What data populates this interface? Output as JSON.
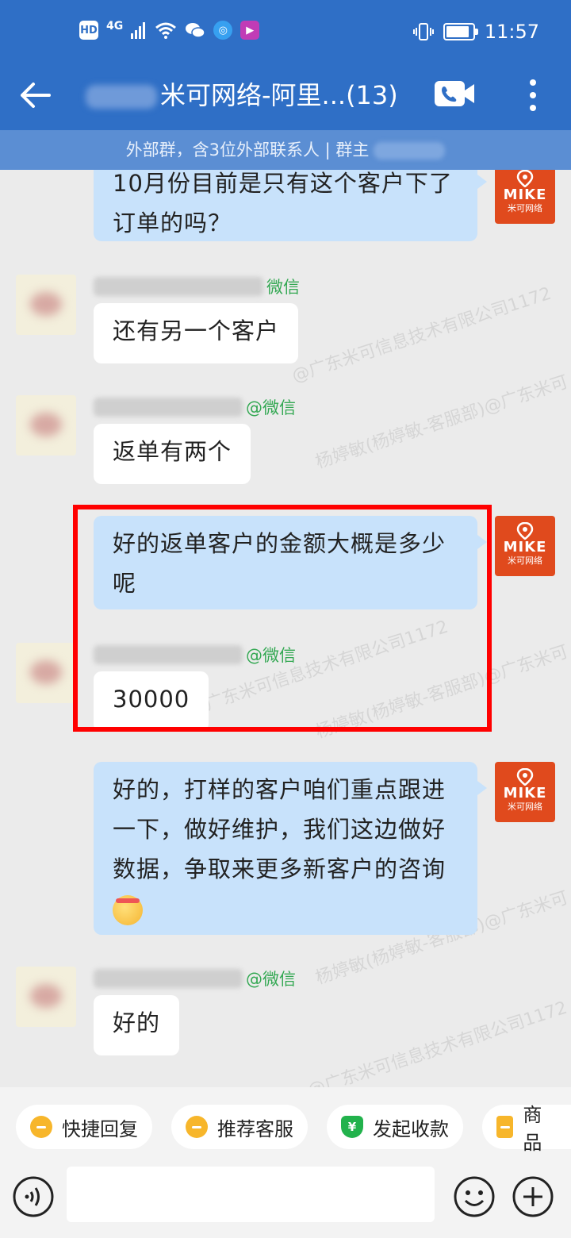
{
  "status_bar": {
    "network_hd": "HD",
    "network_gen": "4G",
    "time": "11:57",
    "icons": [
      "signal-icon",
      "wifi-icon",
      "wechat-icon",
      "browser-icon",
      "app-icon",
      "vibrate-icon",
      "battery-icon"
    ]
  },
  "header": {
    "title": "米可网络-阿里...(13)",
    "subtitle": "外部群，含3位外部联系人 | 群主"
  },
  "watermark": {
    "company_line": "@广东米可信息技术有限公司1172",
    "user_line": "杨婷敏(杨婷敏-客服部)@广东米可"
  },
  "brand": {
    "name": "MIKE",
    "sub": "米可网络",
    "color": "#e04a1d"
  },
  "messages": [
    {
      "from": "me",
      "text": "10月份目前是只有这个客户下了订单的吗？"
    },
    {
      "from": "them",
      "sender_suffix": "微信",
      "text": "还有另一个客户"
    },
    {
      "from": "them",
      "sender_suffix": "@微信",
      "text": "返单有两个"
    },
    {
      "from": "me",
      "text": "好的返单客户的金额大概是多少呢"
    },
    {
      "from": "them",
      "sender_suffix": "@微信",
      "text": "30000"
    },
    {
      "from": "me",
      "text": "好的，打样的客户咱们重点跟进一下，做好维护，我们这边做好数据，争取来更多新客户的咨询"
    },
    {
      "from": "them",
      "sender_suffix": "@微信",
      "text": "好的"
    }
  ],
  "quick_actions": [
    {
      "label": "快捷回复",
      "icon": "quick-reply-icon"
    },
    {
      "label": "推荐客服",
      "icon": "recommend-service-icon"
    },
    {
      "label": "发起收款",
      "icon": "payment-icon"
    },
    {
      "label": "商品",
      "icon": "product-icon"
    }
  ],
  "colors": {
    "header": "#2f6fc6",
    "my_bubble": "#c8e2fb",
    "wechat_tag": "#34a853",
    "highlight": "#ff0000"
  }
}
